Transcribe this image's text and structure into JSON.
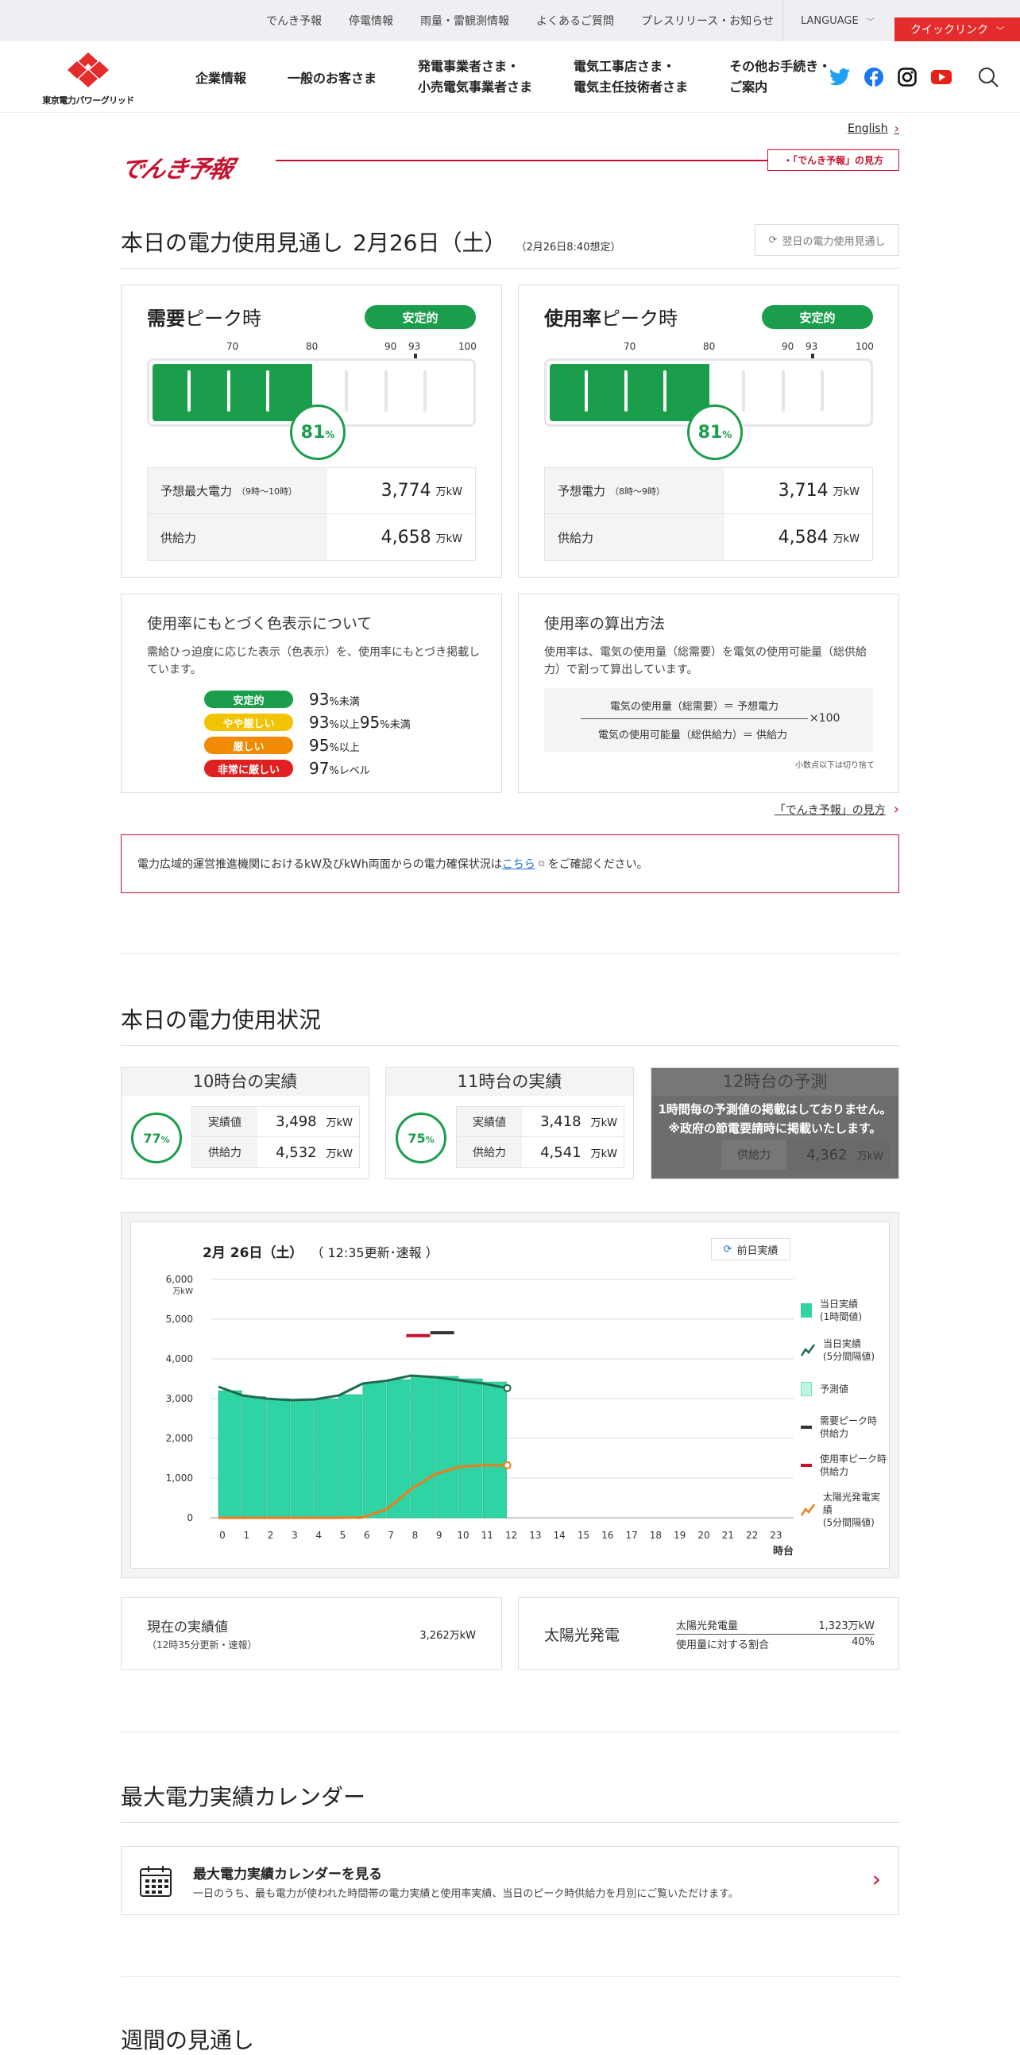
{
  "topbar": {
    "links": [
      "でんき予報",
      "停電情報",
      "雨量・雷観測情報",
      "よくあるご質問",
      "プレスリリース・お知らせ"
    ],
    "language": "LANGUAGE",
    "quick_link": "クイックリンク"
  },
  "header": {
    "logo_text": "東京電力パワーグリッド",
    "nav": [
      {
        "l1": "企業情報",
        "l2": ""
      },
      {
        "l1": "一般のお客さま",
        "l2": ""
      },
      {
        "l1": "発電事業者さま・",
        "l2": "小売電気事業者さま"
      },
      {
        "l1": "電気工事店さま・",
        "l2": "電気主任技術者さま"
      },
      {
        "l1": "その他お手続き・",
        "l2": "ご案内"
      }
    ]
  },
  "english_link": "English",
  "brand": {
    "logo": "でんき予報",
    "howto": "・「でんき予報」の見方"
  },
  "forecast": {
    "title": "本日の電力使用見通し",
    "date": "2月26日（土）",
    "assumed": "（2月26日8:40想定）",
    "next_day_button": "翌日の電力使用見通し",
    "scale": [
      "70",
      "80",
      "90",
      "93",
      "100"
    ],
    "demand": {
      "title_bold": "需要",
      "title_rest": "ピーク時",
      "badge": "安定的",
      "percent": "81",
      "pct_unit": "%",
      "fill_percent": 81,
      "row1_label": "予想最大電力",
      "row1_time": "（9時～10時）",
      "row1_value": "3,774",
      "row2_label": "供給力",
      "row2_value": "4,658",
      "unit": "万kW"
    },
    "usage": {
      "title_bold": "使用率",
      "title_rest": "ピーク時",
      "badge": "安定的",
      "percent": "81",
      "pct_unit": "%",
      "fill_percent": 81,
      "row1_label": "予想電力",
      "row1_time": "（8時～9時）",
      "row1_value": "3,714",
      "row2_label": "供給力",
      "row2_value": "4,584",
      "unit": "万kW"
    }
  },
  "color_info": {
    "title": "使用率にもとづく色表示について",
    "desc": "需給ひっ迫度に応じた表示（色表示）を、使用率にもとづき掲載しています。",
    "levels": [
      {
        "label": "安定的",
        "color": "#1b9e4b",
        "n1": "93",
        "u1": "%未満",
        "n2": "",
        "u2": ""
      },
      {
        "label": "やや厳しい",
        "color": "#f2c300",
        "n1": "93",
        "u1": "%以上",
        "n2": "95",
        "u2": "%未満"
      },
      {
        "label": "厳しい",
        "color": "#f08a00",
        "n1": "95",
        "u1": "%以上",
        "n2": "",
        "u2": ""
      },
      {
        "label": "非常に厳しい",
        "color": "#e02020",
        "n1": "97",
        "u1": "%レベル",
        "n2": "",
        "u2": ""
      }
    ]
  },
  "method": {
    "title": "使用率の算出方法",
    "desc": "使用率は、電気の使用量（総需要）を電気の使用可能量（総供給力）で割って算出しています。",
    "numerator": "電気の使用量（総需要）＝ 予想電力",
    "denominator": "電気の使用可能量（総供給力）＝ 供給力",
    "times": "×100",
    "note": "小数点以下は切り捨て"
  },
  "howto_link": "「でんき予報」の見方",
  "notice": {
    "before": "電力広域的運営推進機関におけるkW及びkWh両面からの電力確保状況は",
    "link": "こちら",
    "after": "をご確認ください。"
  },
  "status": {
    "title": "本日の電力使用状況",
    "hours": [
      {
        "title": "10時台の実績",
        "pct": "77",
        "actual_label": "実績値",
        "actual": "3,498",
        "supply_label": "供給力",
        "supply": "4,532",
        "unit": "万kW"
      },
      {
        "title": "11時台の実績",
        "pct": "75",
        "actual_label": "実績値",
        "actual": "3,418",
        "supply_label": "供給力",
        "supply": "4,541",
        "unit": "万kW"
      }
    ],
    "pred": {
      "title": "12時台の予測",
      "supply_label": "供給力",
      "supply": "4,362",
      "unit": "万kW",
      "msg1": "1時間毎の予測値の掲載はしておりません。",
      "msg2": "※政府の節電要請時に掲載いたします。"
    }
  },
  "chart": {
    "date": "2月 26日（土）",
    "update": "（ 12:35更新･速報 ）",
    "prev_button": "前日実績",
    "legend": [
      {
        "l1": "当日実績",
        "l2": "(1時間値)",
        "color": "#2fd4a4"
      },
      {
        "l1": "当日実績",
        "l2": "(5分間隔値)",
        "color": "#1f6b4f"
      },
      {
        "l1": "予測値",
        "l2": "",
        "color": "#bff4e4"
      },
      {
        "l1": "需要ピーク時",
        "l2": "供給力",
        "color": "#333333"
      },
      {
        "l1": "使用率ピーク時",
        "l2": "供給力",
        "color": "#c8102e"
      },
      {
        "l1": "太陽光発電実績",
        "l2": "(5分間隔値)",
        "color": "#f07d1a"
      }
    ],
    "xlabel": "時台",
    "yunit": "万kW"
  },
  "chart_data": {
    "type": "bar",
    "x": [
      0,
      1,
      2,
      3,
      4,
      5,
      6,
      7,
      8,
      9,
      10,
      11,
      12,
      13,
      14,
      15,
      16,
      17,
      18,
      19,
      20,
      21,
      22,
      23
    ],
    "yticks": [
      "0",
      "1,000",
      "2,000",
      "3,000",
      "4,000",
      "5,000",
      "6,000"
    ],
    "ylim": [
      0,
      6000
    ],
    "series": [
      {
        "name": "当日実績(1時間値)",
        "values": [
          3200,
          3050,
          3000,
          2980,
          2990,
          3100,
          3400,
          3480,
          3560,
          3560,
          3498,
          3418
        ]
      },
      {
        "name": "当日実績(5分間隔値)",
        "values": [
          3300,
          3080,
          3000,
          2960,
          2980,
          3080,
          3380,
          3450,
          3580,
          3540,
          3460,
          3380,
          3262
        ]
      },
      {
        "name": "太陽光発電実績(5分間隔値)",
        "values": [
          0,
          0,
          0,
          0,
          0,
          0,
          10,
          220,
          720,
          1100,
          1280,
          1323,
          1323
        ]
      },
      {
        "name": "需要ピーク時供給力",
        "points": [
          {
            "x": 9,
            "y": 4658
          }
        ]
      },
      {
        "name": "使用率ピーク時供給力",
        "points": [
          {
            "x": 8,
            "y": 4584
          }
        ]
      }
    ]
  },
  "current": {
    "title": "現在の実績値",
    "sub": "（12時35分更新・速報）",
    "value": "3,262万kW"
  },
  "solar": {
    "title": "太陽光発電",
    "r1_label": "太陽光発電量",
    "r1_value": "1,323万kW",
    "r2_label": "使用量に対する割合",
    "r2_value": "40%"
  },
  "calendar": {
    "section_title": "最大電力実績カレンダー",
    "card_title": "最大電力実績カレンダーを見る",
    "card_desc": "一日のうち、最も電力が使われた時間帯の電力実績と使用率実績、当日のピーク時供給力を月別にご覧いただけます。"
  },
  "weekly_title": "週間の見通し"
}
